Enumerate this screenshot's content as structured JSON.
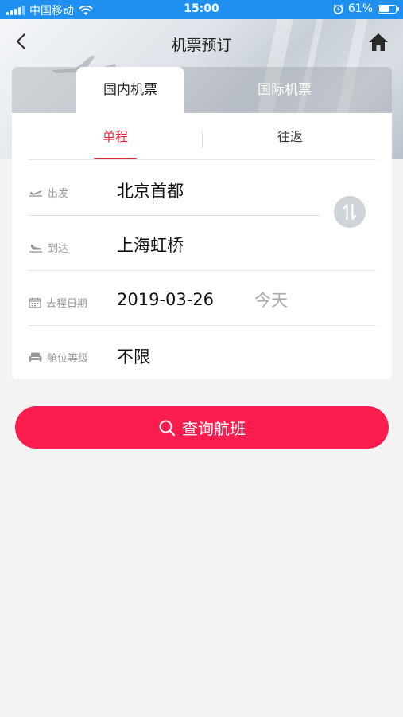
{
  "status_bar": {
    "carrier": "中国移动",
    "time": "15:00",
    "battery": "61%",
    "battery_level": 0.61
  },
  "nav": {
    "title": "机票预订"
  },
  "flight_tabs": [
    {
      "label": "国内机票",
      "active": true
    },
    {
      "label": "国际机票",
      "active": false
    }
  ],
  "trip_tabs": [
    {
      "label": "单程",
      "active": true
    },
    {
      "label": "往返",
      "active": false
    }
  ],
  "form": {
    "departure": {
      "label": "出发",
      "value": "北京首都"
    },
    "arrival": {
      "label": "到达",
      "value": "上海虹桥"
    },
    "date": {
      "label": "去程日期",
      "value": "2019-03-26",
      "note": "今天"
    },
    "cabin": {
      "label": "舱位等级",
      "value": "不限"
    }
  },
  "search_button": {
    "label": "查询航班"
  },
  "colors": {
    "accent": "#e8213c",
    "button": "#fb1d4d",
    "status_bar": "#1f8ff0"
  }
}
